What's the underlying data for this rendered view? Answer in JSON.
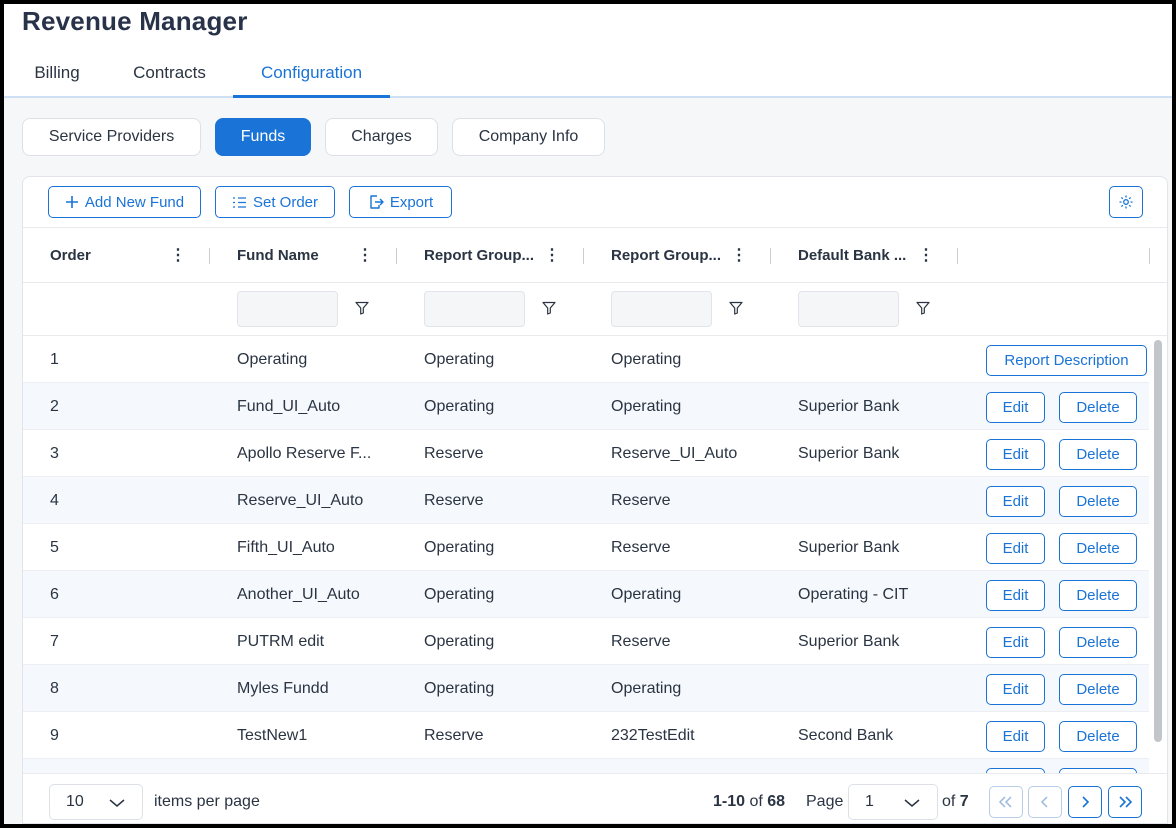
{
  "app": {
    "title": "Revenue Manager"
  },
  "main_tabs": [
    {
      "label": "Billing"
    },
    {
      "label": "Contracts"
    },
    {
      "label": "Configuration",
      "active": true
    }
  ],
  "sub_tabs": [
    {
      "label": "Service Providers"
    },
    {
      "label": "Funds",
      "active": true
    },
    {
      "label": "Charges"
    },
    {
      "label": "Company Info"
    }
  ],
  "toolbar": {
    "add_label": "Add New Fund",
    "set_order_label": "Set Order",
    "export_label": "Export"
  },
  "columns": [
    {
      "label": "Order"
    },
    {
      "label": "Fund Name"
    },
    {
      "label": "Report Group..."
    },
    {
      "label": "Report Group..."
    },
    {
      "label": "Default Bank ..."
    }
  ],
  "actions": {
    "report_description": "Report Description",
    "edit": "Edit",
    "delete": "Delete"
  },
  "rows": [
    {
      "order": "1",
      "fund_name": "Operating",
      "report_group_1": "Operating",
      "report_group_2": "Operating",
      "default_bank": "",
      "action": "report"
    },
    {
      "order": "2",
      "fund_name": "Fund_UI_Auto",
      "report_group_1": "Operating",
      "report_group_2": "Operating",
      "default_bank": "Superior Bank",
      "action": "edit_delete"
    },
    {
      "order": "3",
      "fund_name": "Apollo Reserve F...",
      "report_group_1": "Reserve",
      "report_group_2": "Reserve_UI_Auto",
      "default_bank": "Superior Bank",
      "action": "edit_delete"
    },
    {
      "order": "4",
      "fund_name": "Reserve_UI_Auto",
      "report_group_1": "Reserve",
      "report_group_2": "Reserve",
      "default_bank": "",
      "action": "edit_delete"
    },
    {
      "order": "5",
      "fund_name": "Fifth_UI_Auto",
      "report_group_1": "Operating",
      "report_group_2": "Reserve",
      "default_bank": "Superior Bank",
      "action": "edit_delete"
    },
    {
      "order": "6",
      "fund_name": "Another_UI_Auto",
      "report_group_1": "Operating",
      "report_group_2": "Operating",
      "default_bank": "Operating - CIT",
      "action": "edit_delete"
    },
    {
      "order": "7",
      "fund_name": "PUTRM edit",
      "report_group_1": "Operating",
      "report_group_2": "Reserve",
      "default_bank": "Superior Bank",
      "action": "edit_delete"
    },
    {
      "order": "8",
      "fund_name": "Myles Fundd",
      "report_group_1": "Operating",
      "report_group_2": "Operating",
      "default_bank": "",
      "action": "edit_delete"
    },
    {
      "order": "9",
      "fund_name": "TestNew1",
      "report_group_1": "Reserve",
      "report_group_2": "232TestEdit",
      "default_bank": "Second Bank",
      "action": "edit_delete"
    },
    {
      "order": "",
      "fund_name": "",
      "report_group_1": "",
      "report_group_2": "",
      "default_bank": "",
      "action": "edit_delete"
    }
  ],
  "pagination": {
    "page_size": "10",
    "items_per_page_label": "items per page",
    "range": "1-10",
    "of_label": "of",
    "total": "68",
    "page_label": "Page",
    "current_page": "1",
    "total_pages": "7"
  },
  "colors": {
    "accent": "#1a73d6",
    "title": "#28334a",
    "row_alt": "#f5f8fc"
  },
  "icons": [
    "plus-icon",
    "list-order-icon",
    "export-icon",
    "settings-gear-icon",
    "column-menu-icon",
    "filter-icon",
    "chevron-down-icon",
    "first-page-icon",
    "previous-page-icon",
    "next-page-icon",
    "last-page-icon"
  ]
}
